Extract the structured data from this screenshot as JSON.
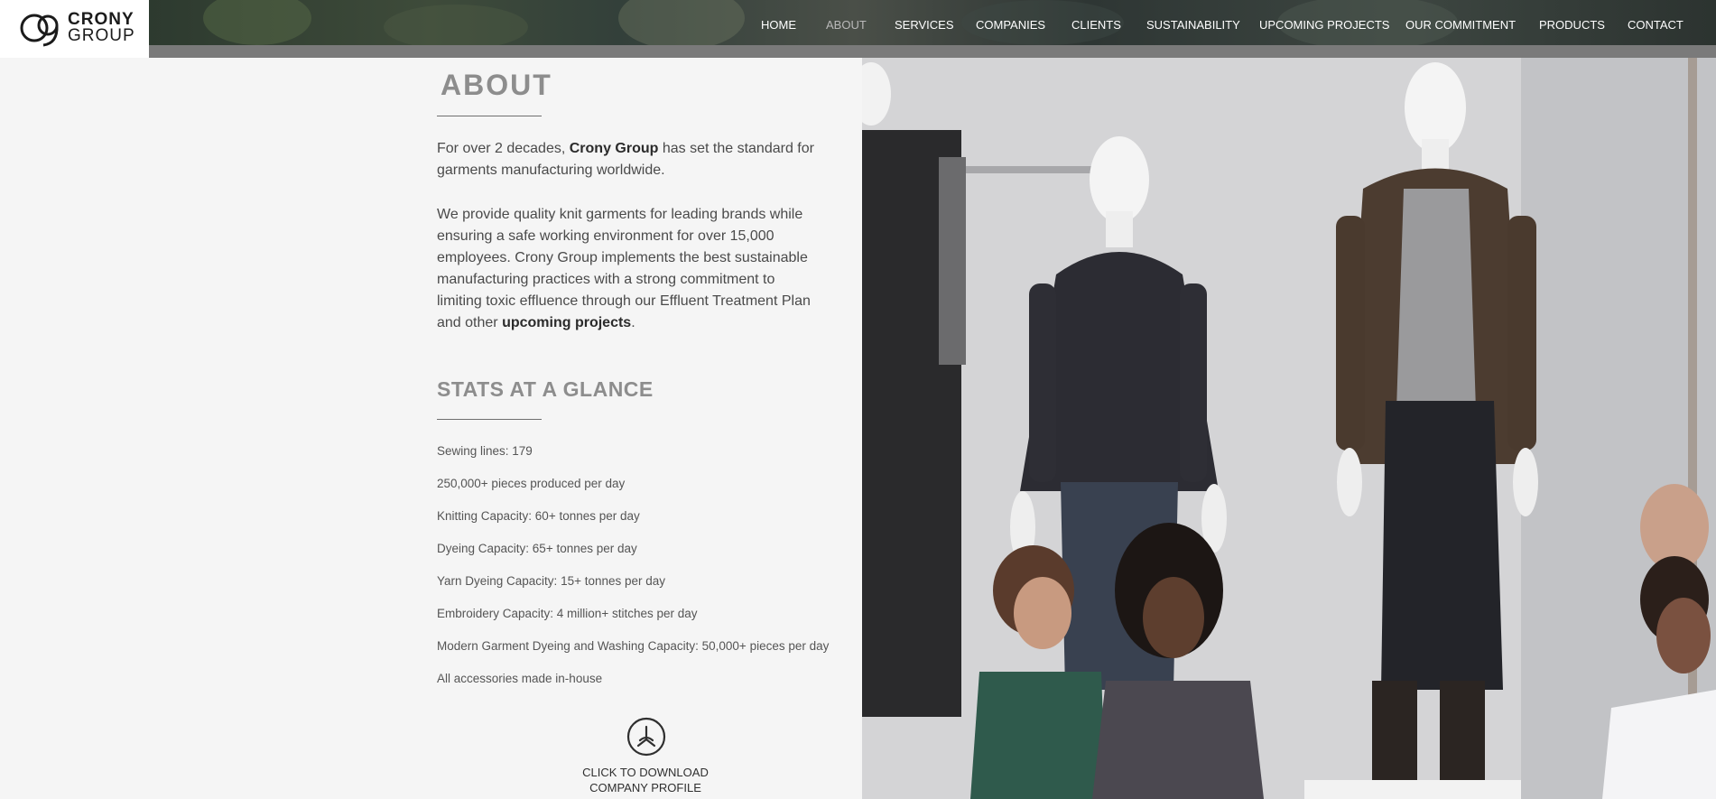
{
  "brand": {
    "line1": "CRONY",
    "line2": "GROUP"
  },
  "nav": {
    "items": [
      {
        "label": "HOME"
      },
      {
        "label": "ABOUT"
      },
      {
        "label": "SERVICES"
      },
      {
        "label": "COMPANIES"
      },
      {
        "label": "CLIENTS"
      },
      {
        "label": "SUSTAINABILITY"
      },
      {
        "label": "UPCOMING PROJECTS"
      },
      {
        "label": "OUR COMMITMENT"
      },
      {
        "label": "PRODUCTS"
      },
      {
        "label": "CONTACT"
      }
    ],
    "active": "ABOUT"
  },
  "about": {
    "title": "ABOUT",
    "intro_pre": "For over 2 decades, ",
    "intro_brand": "Crony Group",
    "intro_post": " has set the standard for garments manufacturing worldwide.",
    "body": "We provide quality knit garments for leading brands while ensuring a safe working environment for over 15,000 employees. Crony Group implements the best sustainable manufacturing practices with a strong commitment to limiting toxic effluence through our Effluent Treatment Plan and other ",
    "body_link": "upcoming projects",
    "body_end": "."
  },
  "stats": {
    "title": "STATS AT A GLANCE",
    "items": [
      "Sewing lines: 179",
      "250,000+ pieces produced per day",
      "Knitting Capacity: 60+ tonnes per day",
      "Dyeing Capacity: 65+ tonnes per day",
      "Yarn Dyeing Capacity: 15+ tonnes per day",
      "Embroidery Capacity: 4 million+ stitches per day",
      "Modern Garment Dyeing and Washing Capacity: 50,000+ pieces per day",
      "All accessories made in-house"
    ]
  },
  "download": {
    "line1": "CLICK TO DOWNLOAD",
    "line2": "COMPANY PROFILE"
  },
  "colors": {
    "background": "#f5f5f5",
    "heading_gray": "#8d8d8d",
    "nav_text": "#ffffff",
    "nav_active": "#b9b9b9",
    "header_gray_band": "#7a7a7a"
  }
}
